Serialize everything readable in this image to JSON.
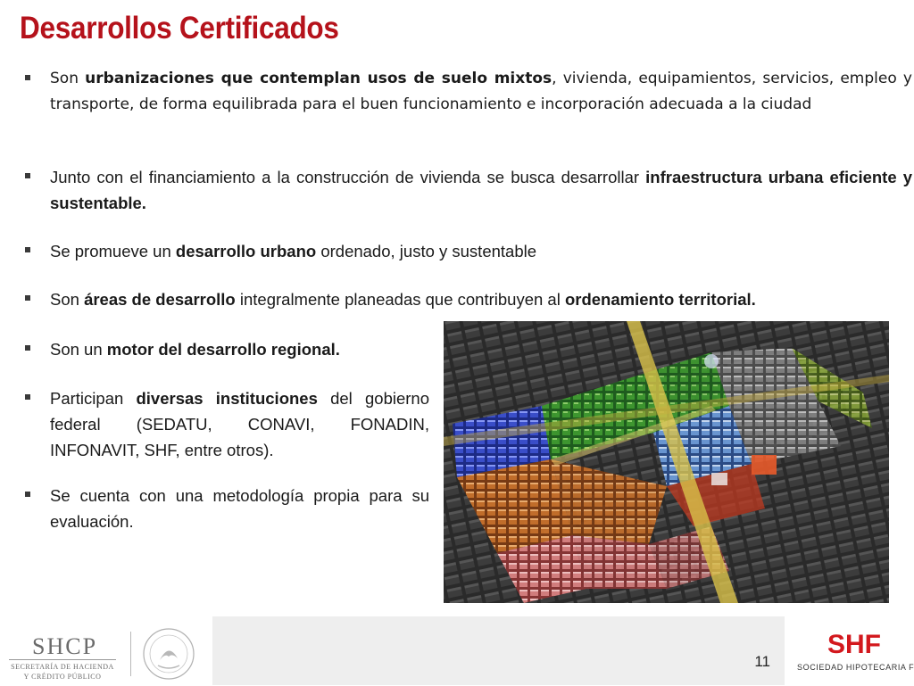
{
  "title": "Desarrollos Certificados",
  "bullets": [
    {
      "parts": [
        {
          "t": "Son ",
          "b": false
        },
        {
          "t": "urbanizaciones que contemplan usos de suelo mixtos",
          "b": true
        },
        {
          "t": ", vivienda, equipamientos, servicios, empleo y transporte, de forma equilibrada para el buen funcionamiento e incorporación adecuada a la ciudad",
          "b": false
        }
      ]
    },
    {
      "parts": [
        {
          "t": "Junto con el financiamiento a la construcción de vivienda se busca desarrollar ",
          "b": false
        },
        {
          "t": "infraestructura urbana eficiente y sustentable.",
          "b": true
        }
      ]
    },
    {
      "parts": [
        {
          "t": "Se promueve un ",
          "b": false
        },
        {
          "t": "desarrollo urbano",
          "b": true
        },
        {
          "t": " ordenado, justo y sustentable",
          "b": false
        }
      ]
    },
    {
      "parts": [
        {
          "t": "Son ",
          "b": false
        },
        {
          "t": "áreas de desarrollo",
          "b": true
        },
        {
          "t": " integralmente planeadas que contribuyen al ",
          "b": false
        },
        {
          "t": "ordenamiento territorial.",
          "b": true
        }
      ]
    },
    {
      "parts": [
        {
          "t": "Son un ",
          "b": false
        },
        {
          "t": "motor del desarrollo regional.",
          "b": true
        }
      ]
    },
    {
      "parts": [
        {
          "t": "Participan ",
          "b": false
        },
        {
          "t": "diversas instituciones",
          "b": true
        },
        {
          "t": " del gobierno federal (SEDATU, CONAVI, FONADIN, INFONAVIT, SHF, entre otros).",
          "b": false
        }
      ]
    },
    {
      "parts": [
        {
          "t": "Se cuenta con una metodología propia para su evaluación.",
          "b": false
        }
      ]
    }
  ],
  "page_number": "11",
  "logos": {
    "shcp_name": "SHCP",
    "shcp_line1": "SECRETARÍA DE HACIENDA",
    "shcp_line2": "Y CRÉDITO PÚBLICO",
    "shf_mark": "SHF",
    "shf_name": "SOCIEDAD HIPOTECARIA FEDERAL"
  },
  "colors": {
    "title": "#b5121b",
    "shf_red": "#d3181d",
    "footer_band": "#eeeeee"
  }
}
